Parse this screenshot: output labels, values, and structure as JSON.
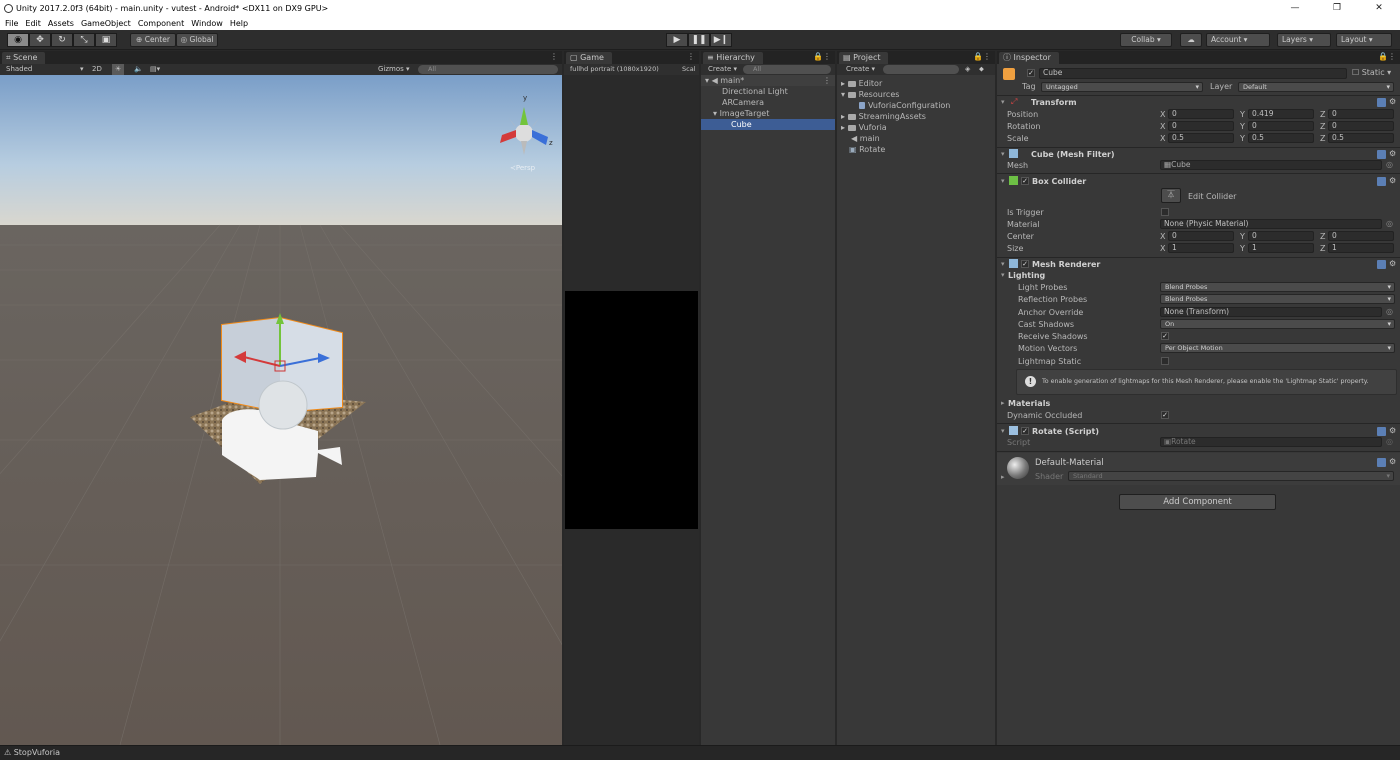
{
  "window": {
    "title": "Unity 2017.2.0f3 (64bit) - main.unity - vutest - Android* <DX11 on DX9 GPU>",
    "min": "—",
    "max": "❐",
    "close": "✕"
  },
  "menu": [
    "File",
    "Edit",
    "Assets",
    "GameObject",
    "Component",
    "Window",
    "Help"
  ],
  "toolbar": {
    "pivot": "Center",
    "space": "Global",
    "collab": "Collab ▾",
    "account": "Account",
    "layers": "Layers",
    "layout": "Layout"
  },
  "scene": {
    "tab": "Scene",
    "shading": "Shaded",
    "mode2d": "2D",
    "gizmos": "Gizmos",
    "search": "All",
    "persp": "Persp",
    "gizmo_y": "y",
    "gizmo_z": "z"
  },
  "game": {
    "tab": "Game",
    "resolution": "fullhd portrait (1080x1920)",
    "scale": "Scal"
  },
  "hierarchy": {
    "tab": "Hierarchy",
    "create": "Create",
    "search": "All",
    "items": [
      {
        "label": "main*",
        "depth": 0
      },
      {
        "label": "Directional Light",
        "depth": 1
      },
      {
        "label": "ARCamera",
        "depth": 1
      },
      {
        "label": "ImageTarget",
        "depth": 1
      },
      {
        "label": "Cube",
        "depth": 2
      }
    ]
  },
  "project": {
    "tab": "Project",
    "create": "Create",
    "items": [
      {
        "label": "Editor",
        "depth": 0
      },
      {
        "label": "Resources",
        "depth": 0
      },
      {
        "label": "VuforiaConfiguration",
        "depth": 1
      },
      {
        "label": "StreamingAssets",
        "depth": 0
      },
      {
        "label": "Vuforia",
        "depth": 0
      },
      {
        "label": "main",
        "depth": 0
      },
      {
        "label": "Rotate",
        "depth": 0
      }
    ]
  },
  "inspector": {
    "tab": "Inspector",
    "name": "Cube",
    "static": "Static",
    "tag_label": "Tag",
    "tag": "Untagged",
    "layer_label": "Layer",
    "layer": "Default",
    "transform": {
      "title": "Transform",
      "position": "Position",
      "rotation": "Rotation",
      "scale": "Scale",
      "px": "0",
      "py": "0.419",
      "pz": "0",
      "rx": "0",
      "ry": "0",
      "rz": "0",
      "sx": "0.5",
      "sy": "0.5",
      "sz": "0.5"
    },
    "meshfilter": {
      "title": "Cube (Mesh Filter)",
      "mesh_label": "Mesh",
      "mesh": "Cube"
    },
    "boxcollider": {
      "title": "Box Collider",
      "edit": "Edit Collider",
      "trigger": "Is Trigger",
      "material_label": "Material",
      "material": "None (Physic Material)",
      "center": "Center",
      "cx": "0",
      "cy": "0",
      "cz": "0",
      "size": "Size",
      "sx": "1",
      "sy": "1",
      "sz": "1"
    },
    "meshrenderer": {
      "title": "Mesh Renderer",
      "lighting": "Lighting",
      "light_probes": "Light Probes",
      "light_probes_val": "Blend Probes",
      "reflection_probes": "Reflection Probes",
      "reflection_probes_val": "Blend Probes",
      "anchor": "Anchor Override",
      "anchor_val": "None (Transform)",
      "cast": "Cast Shadows",
      "cast_val": "On",
      "receive": "Receive Shadows",
      "motion": "Motion Vectors",
      "motion_val": "Per Object Motion",
      "lightmap": "Lightmap Static",
      "info": "To enable generation of lightmaps for this Mesh Renderer, please enable the 'Lightmap Static' property.",
      "materials": "Materials",
      "dynamic": "Dynamic Occluded"
    },
    "rotate": {
      "title": "Rotate (Script)",
      "script_label": "Script",
      "script": "Rotate"
    },
    "material": {
      "title": "Default-Material",
      "shader_label": "Shader",
      "shader": "Standard"
    },
    "add": "Add Component",
    "x": "X",
    "y": "Y",
    "z": "Z"
  },
  "status": "StopVuforia"
}
